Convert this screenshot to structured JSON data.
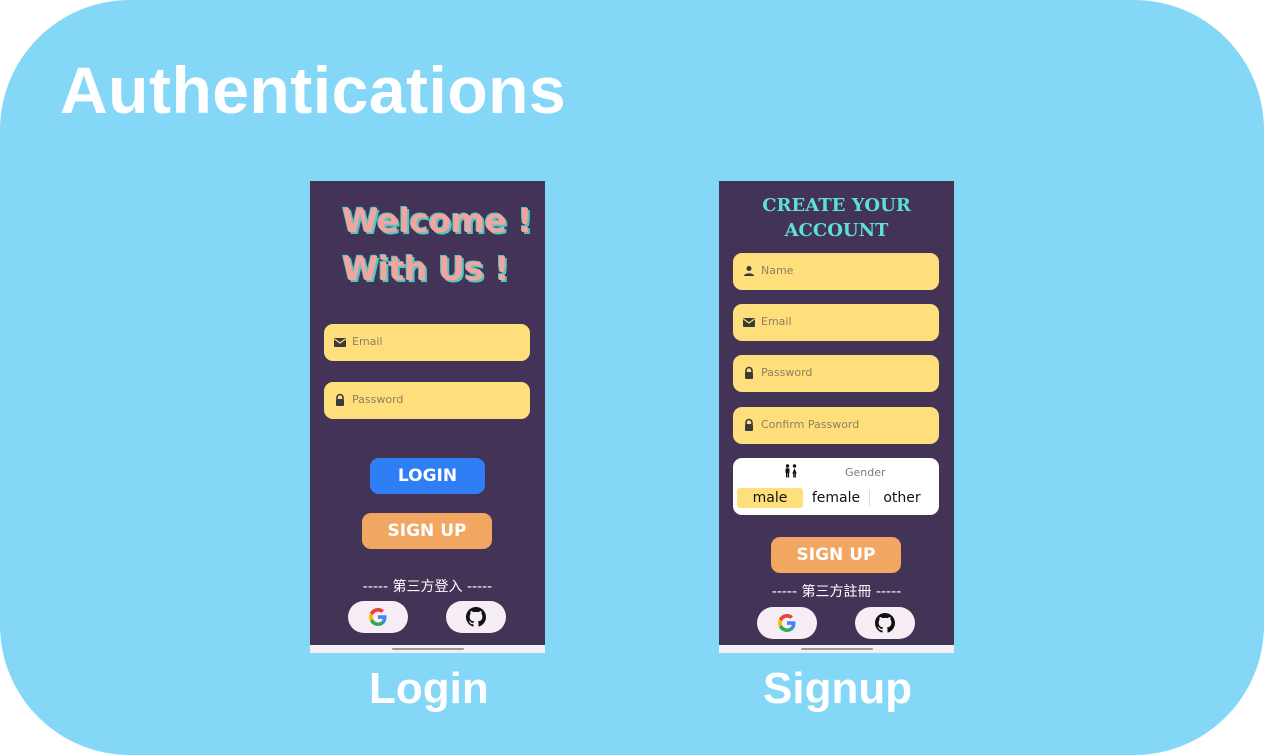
{
  "page": {
    "title": "Authentications"
  },
  "login": {
    "welcome_line1": "Welcome !",
    "welcome_line2": "With Us !",
    "email_placeholder": "Email",
    "password_placeholder": "Password",
    "login_label": "LOGIN",
    "signup_label": "SIGN UP",
    "third_party_text": "----- 第三方登入 -----",
    "caption": "Login"
  },
  "signup": {
    "heading_line1": "CREATE YOUR",
    "heading_line2": "ACCOUNT",
    "name_placeholder": "Name",
    "email_placeholder": "Email",
    "password_placeholder": "Password",
    "confirm_placeholder": "Confirm Password",
    "gender_label": "Gender",
    "gender_options": [
      "male",
      "female",
      "other"
    ],
    "gender_selected": "male",
    "signup_label": "SIGN UP",
    "third_party_text": "----- 第三方註冊 -----",
    "caption": "Signup"
  },
  "icons": {
    "email": "email-icon",
    "lock": "lock-icon",
    "person": "person-icon",
    "gender": "gender-icon",
    "google": "google-icon",
    "github": "github-icon"
  },
  "colors": {
    "background": "#84d7f7",
    "phone_bg": "#433356",
    "field_bg": "#fedf7c",
    "login_button": "#2f7ef6",
    "signup_button": "#f1a662",
    "welcome_text": "#f3a3a0",
    "heading_text": "#5ee0d2"
  }
}
